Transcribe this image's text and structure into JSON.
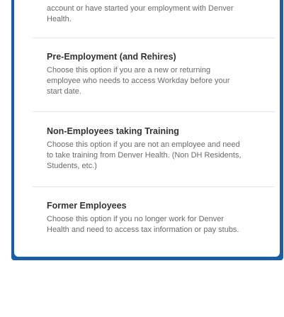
{
  "options": [
    {
      "title": "",
      "desc_lines": [
        "account or have started your employment with Denver",
        "Health."
      ]
    },
    {
      "title": "Pre-Employment (and Rehires)",
      "desc_lines": [
        "Choose this option if you are a new or returning",
        "employee who needs to access Workday before your",
        "start date."
      ]
    },
    {
      "title": "Non-Employees taking Training",
      "desc_lines": [
        "Choose this option if you are not an employee and need",
        "to take training from Denver Health. (Non DH Residents,",
        "Students, etc.)"
      ]
    },
    {
      "title": "Former Employees",
      "desc_lines": [
        "Choose this option if you no longer work for Denver",
        "Health and need to access tax information or pay stubs."
      ]
    }
  ],
  "icons": {
    "chevron": "chevron-right-icon"
  },
  "colors": {
    "frame": "#1a5ea8",
    "title": "#333333",
    "description": "#6b6b6b",
    "divider": "#e6e6e6",
    "chevron": "#c8c8c8"
  }
}
